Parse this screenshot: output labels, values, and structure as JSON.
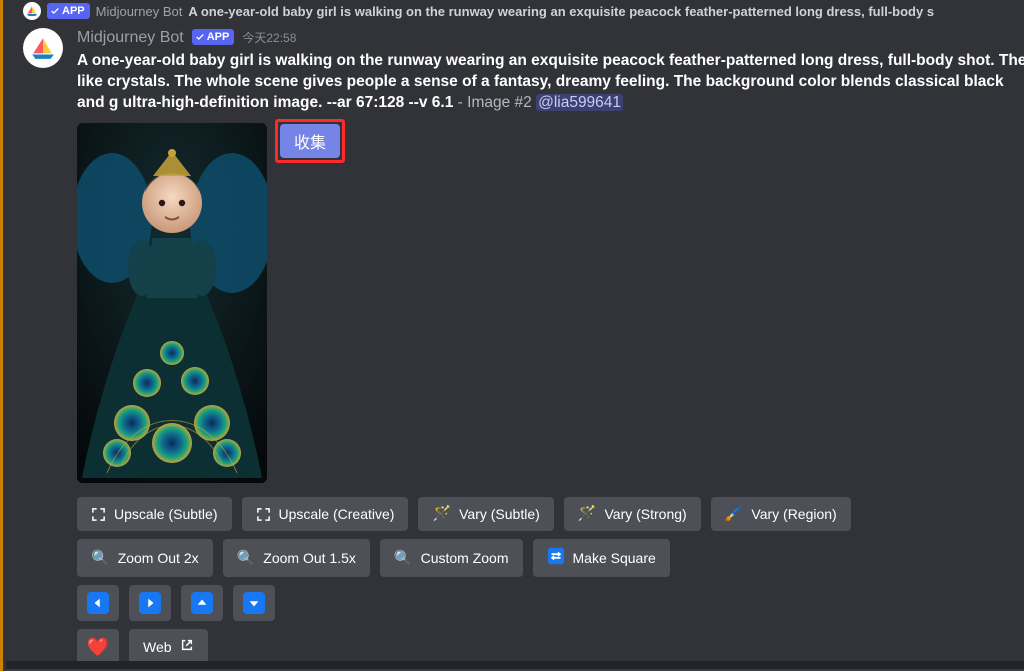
{
  "prev": {
    "bot_name": "Midjourney Bot",
    "prompt": "A one-year-old baby girl is walking on the runway wearing an exquisite peacock feather-patterned long dress, full-body s"
  },
  "app_badge": "APP",
  "message": {
    "bot_name": "Midjourney Bot",
    "timestamp": "今天22:58",
    "prompt_main": "A one-year-old baby girl is walking on the runway wearing an exquisite peacock feather-patterned long dress, full-body shot. The like crystals. The whole scene gives people a sense of a fantasy, dreamy feeling. The background color blends classical black and g ultra-high-definition image. --ar 67:128 --v 6.1",
    "suffix": " - Image #2 ",
    "mention": "@lia599641"
  },
  "collect_label": "收集",
  "buttons": {
    "row1": [
      {
        "label": "Upscale (Subtle)",
        "icon": "upscale"
      },
      {
        "label": "Upscale (Creative)",
        "icon": "upscale"
      },
      {
        "label": "Vary (Subtle)",
        "icon": "wand"
      },
      {
        "label": "Vary (Strong)",
        "icon": "wand"
      },
      {
        "label": "Vary (Region)",
        "icon": "brush"
      }
    ],
    "row2": [
      {
        "label": "Zoom Out 2x",
        "icon": "mag"
      },
      {
        "label": "Zoom Out 1.5x",
        "icon": "mag"
      },
      {
        "label": "Custom Zoom",
        "icon": "mag"
      },
      {
        "label": "Make Square",
        "icon": "swap"
      }
    ],
    "row4": {
      "web": "Web"
    }
  }
}
